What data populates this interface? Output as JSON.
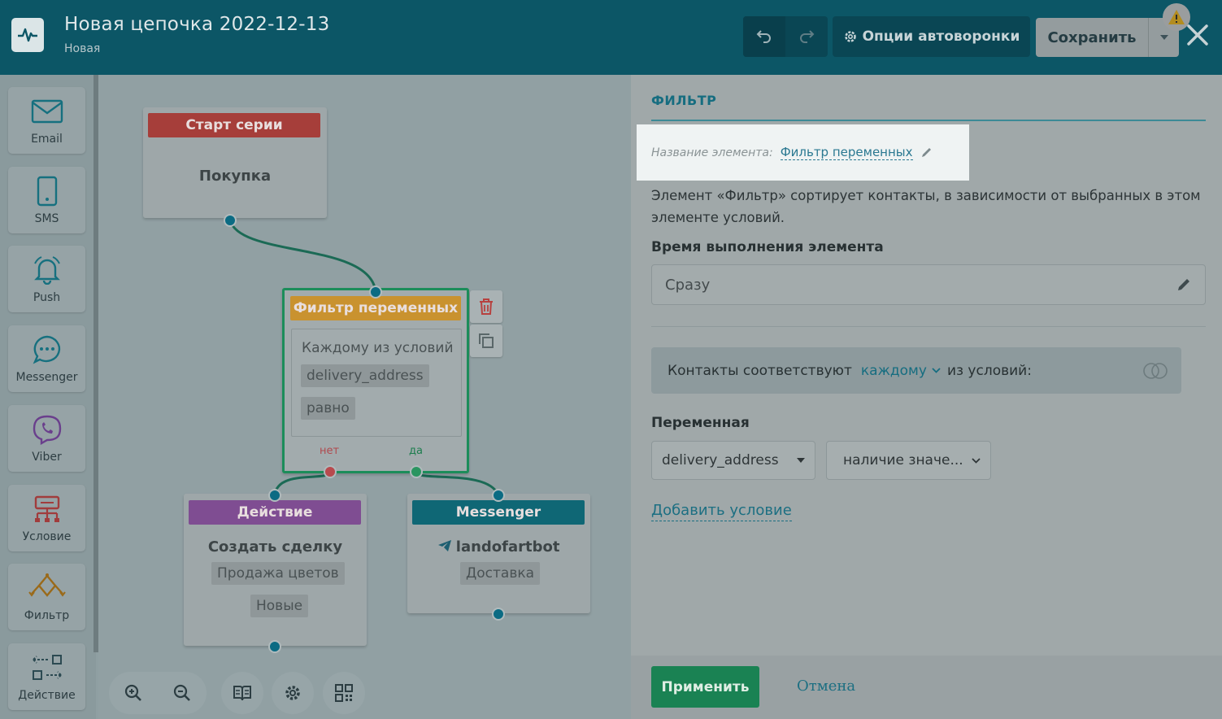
{
  "header": {
    "title": "Новая цепочка 2022-12-13",
    "subtitle": "Новая",
    "options_label": "Опции автоворонки",
    "save_label": "Сохранить"
  },
  "sidebar": {
    "items": [
      {
        "label": "Email",
        "icon": "email-icon"
      },
      {
        "label": "SMS",
        "icon": "phone-icon"
      },
      {
        "label": "Push",
        "icon": "bell-icon"
      },
      {
        "label": "Messenger",
        "icon": "chat-icon"
      },
      {
        "label": "Viber",
        "icon": "viber-icon"
      },
      {
        "label": "Условие",
        "icon": "condition-icon"
      },
      {
        "label": "Фильтр",
        "icon": "filter-icon"
      },
      {
        "label": "Действие",
        "icon": "action-icon"
      }
    ]
  },
  "canvas": {
    "start_node": {
      "header": "Старт серии",
      "body": "Покупка"
    },
    "filter_node": {
      "header": "Фильтр переменных",
      "condition_mode": "Каждому из условий",
      "variable": "delivery_address",
      "operator": "равно",
      "no_label": "нет",
      "yes_label": "да"
    },
    "action_node": {
      "header": "Действие",
      "title": "Создать сделку",
      "tag1": "Продажа цветов",
      "tag2": "Новые"
    },
    "messenger_node": {
      "header": "Messenger",
      "bot": "landofartbot",
      "tag": "Доставка"
    }
  },
  "panel": {
    "tab": "ФИЛЬТР",
    "name_label": "Название элемента:",
    "name_value": "Фильтр переменных",
    "description": "Элемент «Фильтр» сортирует контакты, в зависимости от выбранных в этом элементе условий.",
    "time_title": "Время выполнения элемента",
    "time_value": "Сразу",
    "match_prefix": "Контакты соответствуют",
    "match_mode": "каждому",
    "match_suffix": "из условий:",
    "variable_title": "Переменная",
    "variable_value": "delivery_address",
    "operator_value": "наличие значе...",
    "add_condition": "Добавить условие",
    "apply": "Применить",
    "cancel": "Отмена"
  },
  "colors": {
    "header_bg": "#0c5666",
    "start_header": "#a63e3a",
    "filter_header": "#c9922f",
    "action_header": "#7f4d92",
    "messenger_header": "#0f6775",
    "apply_bg": "#1a8253",
    "accent": "#166d80"
  }
}
